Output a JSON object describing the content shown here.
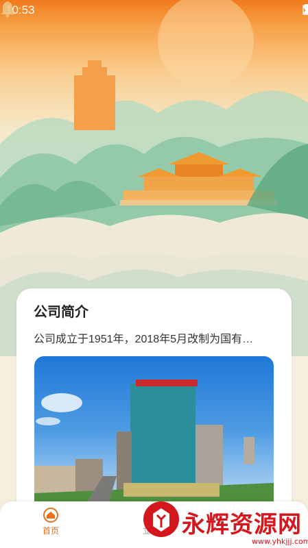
{
  "status_bar": {
    "time": "10:53"
  },
  "card": {
    "title": "公司简介",
    "summary": "公司成立于1951年，2018年5月改制为国有…"
  },
  "tabs": [
    {
      "label": "首页",
      "icon": "home-icon",
      "active": true
    },
    {
      "label": "立…",
      "icon": "hidden-icon",
      "active": false
    },
    {
      "label": "",
      "icon": "hidden-icon",
      "active": false
    }
  ],
  "watermark": {
    "text": "永辉资源网",
    "url": "www.yhkjjj.com"
  },
  "colors": {
    "accent": "#e8701c",
    "header_top": "#f07a1c",
    "watermark": "#d4161d"
  }
}
